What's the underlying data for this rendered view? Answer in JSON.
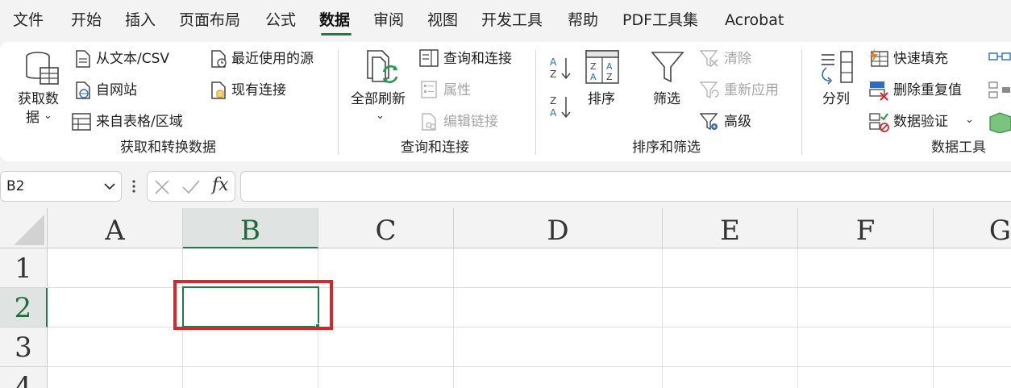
{
  "menu": {
    "tabs": [
      {
        "label": "文件"
      },
      {
        "label": "开始"
      },
      {
        "label": "插入"
      },
      {
        "label": "页面布局"
      },
      {
        "label": "公式"
      },
      {
        "label": "数据",
        "active": true
      },
      {
        "label": "审阅"
      },
      {
        "label": "视图"
      },
      {
        "label": "开发工具"
      },
      {
        "label": "帮助"
      },
      {
        "label": "PDF工具集"
      },
      {
        "label": "Acrobat"
      }
    ]
  },
  "ribbon": {
    "get_transform": {
      "group_label": "获取和转换数据",
      "get_data_line1": "获取数",
      "get_data_line2": "据",
      "from_text": "从文本/CSV",
      "from_web": "自网站",
      "from_table": "来自表格/区域",
      "recent_sources": "最近使用的源",
      "existing_connections": "现有连接"
    },
    "queries": {
      "group_label": "查询和连接",
      "refresh_all": "全部刷新",
      "queries_connections": "查询和连接",
      "properties": "属性",
      "edit_links": "编辑链接"
    },
    "sort_filter": {
      "group_label": "排序和筛选",
      "sort": "排序",
      "filter": "筛选",
      "clear": "清除",
      "reapply": "重新应用",
      "advanced": "高级",
      "sort_az": "A Z",
      "sort_za": "Z A"
    },
    "data_tools": {
      "group_label": "数据工具",
      "text_to_columns": "分列",
      "flash_fill": "快速填充",
      "remove_duplicates": "删除重复值",
      "data_validation": "数据验证"
    }
  },
  "formula_bar": {
    "name_box": "B2",
    "formula": "",
    "fx_label": "fx"
  },
  "grid": {
    "columns": [
      "A",
      "B",
      "C",
      "D",
      "E",
      "F",
      "G"
    ],
    "rows": [
      "1",
      "2",
      "3",
      "4"
    ],
    "selected_cell": "B2"
  },
  "colors": {
    "accent": "#1f7b45",
    "highlight": "#d9262b"
  }
}
